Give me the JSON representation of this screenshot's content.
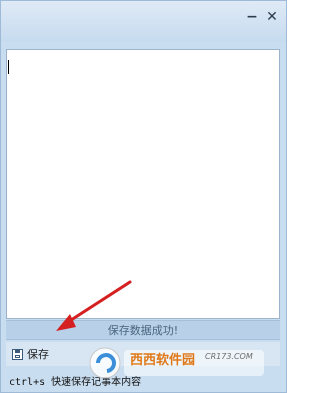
{
  "titlebar": {
    "min_glyph": "−",
    "close_glyph": "✕"
  },
  "editor": {
    "content": ""
  },
  "status": {
    "message": "保存数据成功!"
  },
  "toolbar": {
    "save_label": "保存"
  },
  "hint": {
    "text": "ctrl+s 快速保存记事本内容"
  },
  "watermark": {
    "brand_text": "西西软件园",
    "site_text": "CR173.COM"
  },
  "colors": {
    "window_bg": "#c8ddf0",
    "status_bg": "#b8d1e8",
    "arrow": "#d42020"
  },
  "icons": {
    "minimize": "minimize-icon",
    "close": "close-icon",
    "save": "save-disk-icon",
    "annotation": "red-arrow"
  }
}
